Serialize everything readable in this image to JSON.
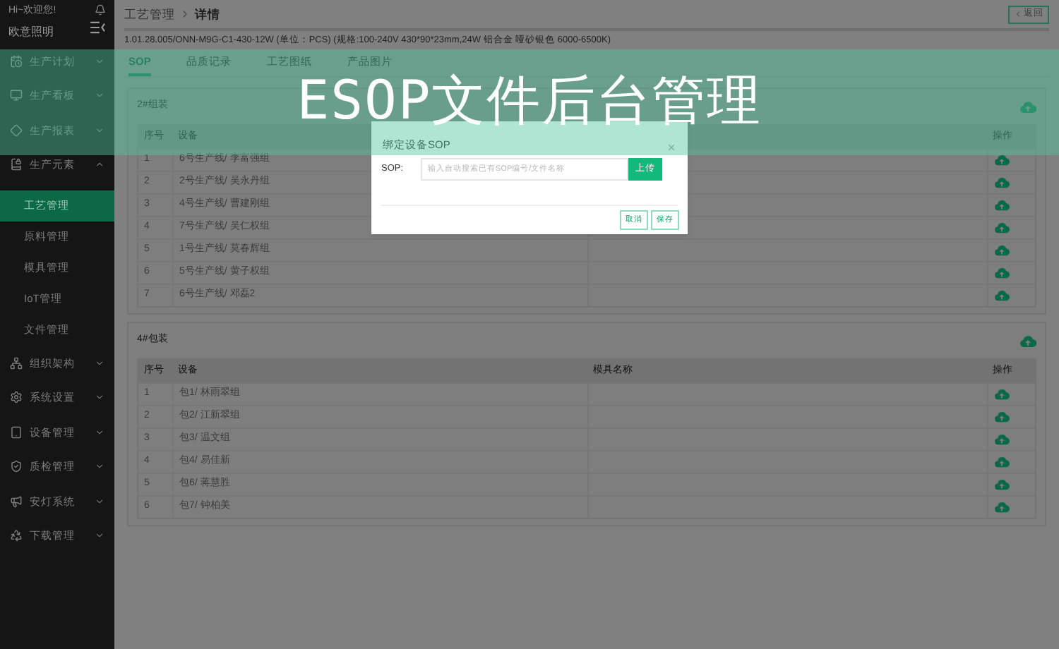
{
  "sidebar": {
    "greeting": "Hi~欢迎您!",
    "user": "欧意照明",
    "nav": [
      {
        "label": "生产计划",
        "expanded": false
      },
      {
        "label": "生产看板",
        "expanded": false
      },
      {
        "label": "生产报表",
        "expanded": false
      },
      {
        "label": "生产元素",
        "expanded": true,
        "children": [
          {
            "label": "工艺管理",
            "selected": true
          },
          {
            "label": "原料管理",
            "selected": false
          },
          {
            "label": "模具管理",
            "selected": false
          },
          {
            "label": "IoT管理",
            "selected": false
          },
          {
            "label": "文件管理",
            "selected": false
          }
        ]
      },
      {
        "label": "组织架构",
        "expanded": false
      },
      {
        "label": "系统设置",
        "expanded": false
      },
      {
        "label": "设备管理",
        "expanded": false
      },
      {
        "label": "质检管理",
        "expanded": false
      },
      {
        "label": "安灯系统",
        "expanded": false
      },
      {
        "label": "下载管理",
        "expanded": false
      }
    ]
  },
  "breadcrumb": [
    "工艺管理",
    "详情"
  ],
  "back_button": "返回",
  "product_line": "1.01.28.005/ONN-M9G-C1-430-12W (单位：PCS) (规格:100-240V 430*90*23mm,24W 铝合金 哑砂银色 6000-6500K)",
  "tabs": [
    {
      "label": "SOP",
      "selected": true
    },
    {
      "label": "品质记录",
      "selected": false
    },
    {
      "label": "工艺图纸",
      "selected": false
    },
    {
      "label": "产品图片",
      "selected": false
    }
  ],
  "groups": [
    {
      "title": "2#组装",
      "columns": [
        {
          "kind": "index",
          "label": "序号"
        },
        {
          "kind": "device",
          "label": "设备"
        },
        {
          "kind": "mold"
        },
        {
          "kind": "action",
          "label": "操作"
        }
      ],
      "rows": [
        {
          "no": "1",
          "device": "6号生产线/ 李富强组"
        },
        {
          "no": "2",
          "device": "2号生产线/ 吴永丹组"
        },
        {
          "no": "3",
          "device": "4号生产线/ 曹建刚组"
        },
        {
          "no": "4",
          "device": "7号生产线/ 吴仁权组"
        },
        {
          "no": "5",
          "device": "1号生产线/ 莫春辉组"
        },
        {
          "no": "6",
          "device": "5号生产线/ 黄子权组"
        },
        {
          "no": "7",
          "device": "6号生产线/ 邓磊2"
        }
      ]
    },
    {
      "title": "4#包装",
      "columns": [
        {
          "kind": "index",
          "label": "序号"
        },
        {
          "kind": "device",
          "label": "设备"
        },
        {
          "kind": "mold",
          "label": "模具名称"
        },
        {
          "kind": "action",
          "label": "操作"
        }
      ],
      "rows": [
        {
          "no": "1",
          "device": "包1/ 林雨翠组"
        },
        {
          "no": "2",
          "device": "包2/ 江新翠组"
        },
        {
          "no": "3",
          "device": "包3/ 温文组"
        },
        {
          "no": "4",
          "device": "包4/ 易佳新"
        },
        {
          "no": "5",
          "device": "包6/ 蒋慧胜"
        },
        {
          "no": "6",
          "device": "包7/ 钟柏美"
        }
      ]
    }
  ],
  "modal": {
    "title": "绑定设备SOP",
    "field_label": "SOP:",
    "placeholder": "输入自动搜索已有SOP编号/文件名称",
    "upload_button": "上传",
    "buttons": [
      "取消",
      "保存"
    ]
  },
  "banner": {
    "title": "ESOP文件后台管理"
  }
}
